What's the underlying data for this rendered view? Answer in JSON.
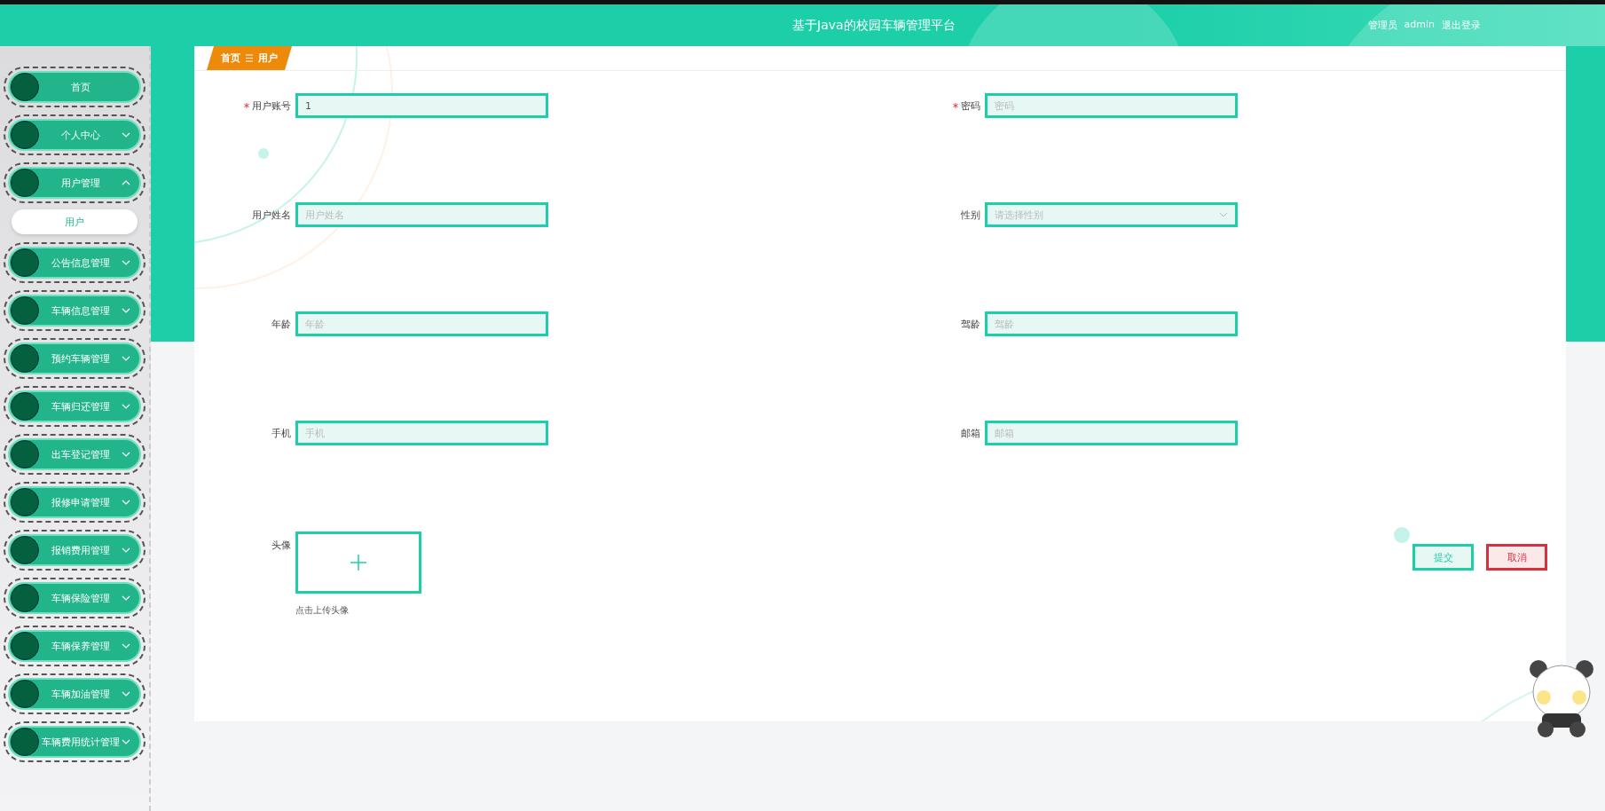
{
  "header": {
    "title": "基于Java的校园车辆管理平台",
    "user_role": "管理员",
    "user_name": "admin",
    "logout": "退出登录"
  },
  "sidebar": {
    "items": [
      {
        "label": "首页",
        "kind": "link"
      },
      {
        "label": "个人中心",
        "kind": "menu",
        "expanded": false
      },
      {
        "label": "用户管理",
        "kind": "menu",
        "expanded": true,
        "children": [
          {
            "label": "用户"
          }
        ]
      },
      {
        "label": "公告信息管理",
        "kind": "menu",
        "expanded": false
      },
      {
        "label": "车辆信息管理",
        "kind": "menu",
        "expanded": false
      },
      {
        "label": "预约车辆管理",
        "kind": "menu",
        "expanded": false
      },
      {
        "label": "车辆归还管理",
        "kind": "menu",
        "expanded": false
      },
      {
        "label": "出车登记管理",
        "kind": "menu",
        "expanded": false
      },
      {
        "label": "报修申请管理",
        "kind": "menu",
        "expanded": false
      },
      {
        "label": "报销费用管理",
        "kind": "menu",
        "expanded": false
      },
      {
        "label": "车辆保险管理",
        "kind": "menu",
        "expanded": false
      },
      {
        "label": "车辆保养管理",
        "kind": "menu",
        "expanded": false
      },
      {
        "label": "车辆加油管理",
        "kind": "menu",
        "expanded": false
      },
      {
        "label": "车辆费用统计管理",
        "kind": "menu",
        "expanded": false
      }
    ]
  },
  "breadcrumb": [
    "首页",
    "用户"
  ],
  "form": {
    "fields": [
      {
        "label": "用户账号",
        "kind": "text",
        "required": true,
        "value": "1"
      },
      {
        "label": "密码",
        "kind": "text",
        "required": true,
        "placeholder": "密码"
      },
      {
        "label": "用户姓名",
        "kind": "text",
        "required": false,
        "placeholder": "用户姓名"
      },
      {
        "label": "性别",
        "kind": "select",
        "required": false,
        "placeholder": "请选择性别"
      },
      {
        "label": "年龄",
        "kind": "text",
        "required": false,
        "placeholder": "年龄"
      },
      {
        "label": "驾龄",
        "kind": "text",
        "required": false,
        "placeholder": "驾龄"
      },
      {
        "label": "手机",
        "kind": "text",
        "required": false,
        "placeholder": "手机"
      },
      {
        "label": "邮箱",
        "kind": "text",
        "required": false,
        "placeholder": "邮箱"
      }
    ],
    "upload": {
      "label": "头像",
      "hint": "点击上传头像"
    },
    "buttons": [
      {
        "label": "提交",
        "kind": "primary"
      },
      {
        "label": "取消",
        "kind": "danger"
      }
    ]
  }
}
